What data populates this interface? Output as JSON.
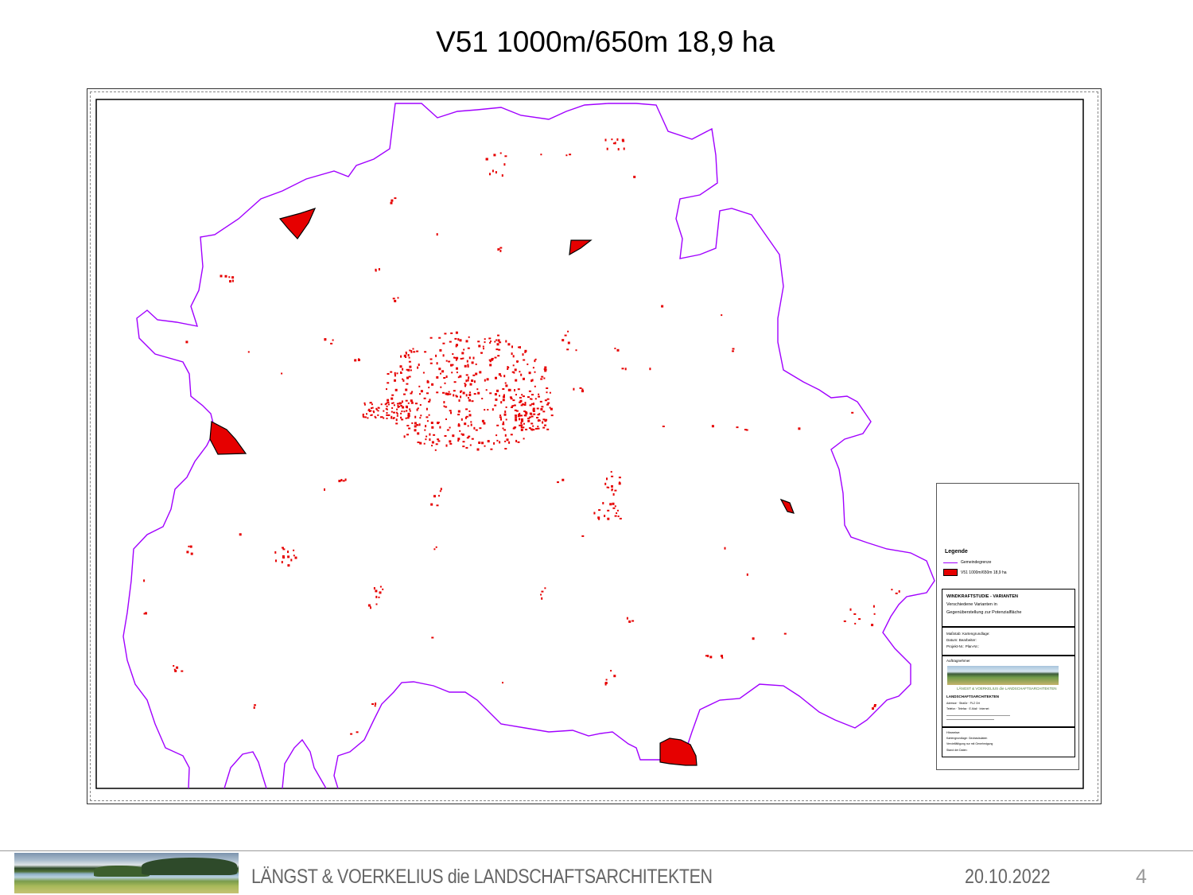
{
  "slide": {
    "title": "V51 1000m/650m 18,9 ha"
  },
  "map": {
    "boundary_color": "#a100ff",
    "potential_area_color": "#e60000",
    "settlement_color": "#e60000",
    "legend": {
      "title": "Legende",
      "items": [
        {
          "symbol": "line",
          "label": "Gemeindegrenze"
        },
        {
          "symbol": "fill",
          "label": "V51 1000m/650m 18,9 ha"
        }
      ],
      "study_box": [
        "WINDKRAFTSTUDIE - VARIANTEN",
        "Verschiedene Varianten in",
        "Gegenüberstellung zur Potenzialfläche"
      ],
      "meta_box": [
        "Maßstab:          Kartengrundlage:",
        "Datum:            Bearbeiter:",
        "Projekt-Nr.:      Plan-Nr.:"
      ],
      "credits_header": "Auftragnehmer",
      "photo_caption": "LÄNGST & VOERKELIUS die LANDSCHAFTSARCHITEKTEN",
      "credits_lines": [
        "LANDSCHAFTSARCHITEKTEN",
        "Adresse · Straße · PLZ Ort",
        "Telefon · Telefax · E-Mail · Internet"
      ],
      "notes_header": "Hinweise:",
      "notes_lines": [
        "Kartengrundlage: Geobasisdaten",
        "Vervielfältigung nur mit Genehmigung",
        "Stand der Daten:"
      ]
    }
  },
  "footer": {
    "company": "LÄNGST & VOERKELIUS die LANDSCHAFTSARCHITEKTEN",
    "date": "20.10.2022",
    "page": "4"
  }
}
